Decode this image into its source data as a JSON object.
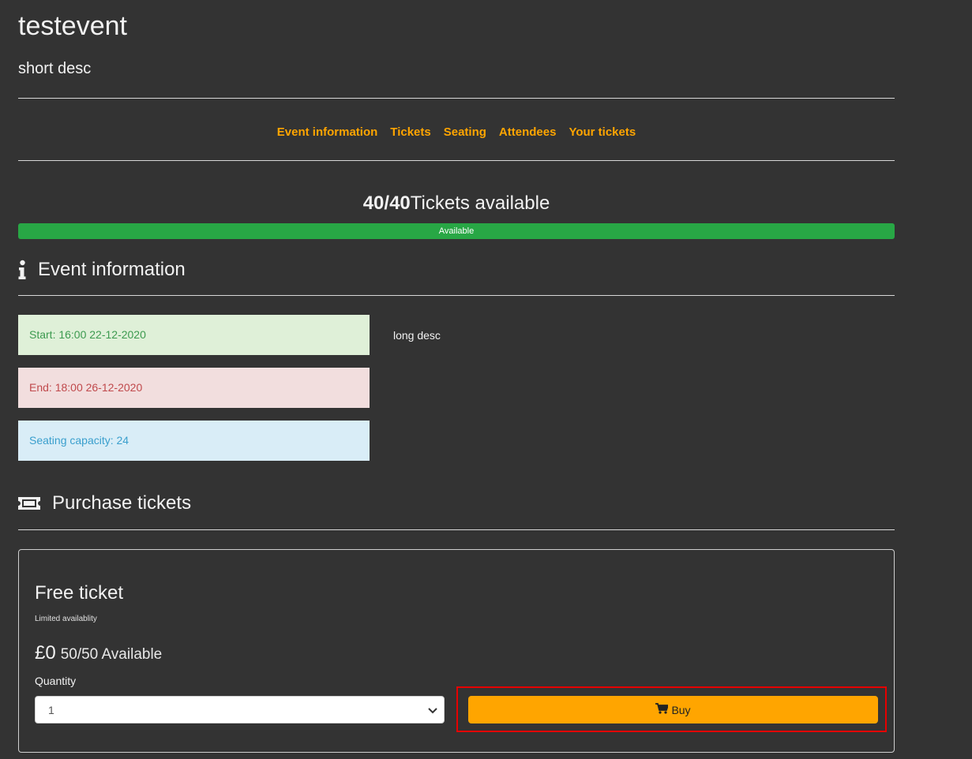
{
  "event": {
    "title": "testevent",
    "short_desc": "short desc",
    "long_desc": "long desc"
  },
  "nav": {
    "items": [
      "Event information",
      "Tickets",
      "Seating",
      "Attendees",
      "Your tickets"
    ]
  },
  "availability": {
    "count": "40/40",
    "label": "Tickets available",
    "progress_label": "Available",
    "progress_fraction": 1.0,
    "progress_color": "#28a745"
  },
  "event_info": {
    "heading": "Event information",
    "icon": "info-icon",
    "start": "Start: 16:00 22-12-2020",
    "end": "End: 18:00 26-12-2020",
    "capacity": "Seating capacity: 24"
  },
  "purchase": {
    "heading": "Purchase tickets",
    "icon": "ticket-icon",
    "ticket": {
      "name": "Free ticket",
      "note": "Limited availablity",
      "price": "£0",
      "available": "50/50 Available",
      "quantity_label": "Quantity",
      "quantity_value": "1",
      "buy_label": "Buy",
      "buy_icon": "shopping-cart-icon"
    }
  },
  "colors": {
    "accent": "#ffa500",
    "background": "#333333",
    "highlight_outline": "#e60000"
  }
}
